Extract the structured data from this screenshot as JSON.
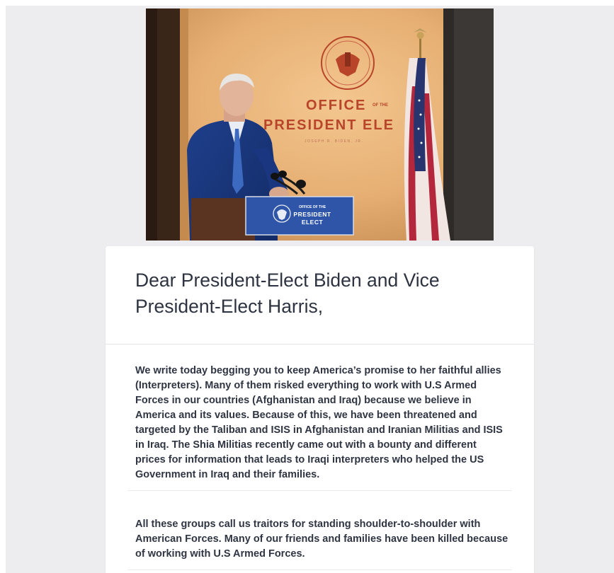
{
  "hero": {
    "backdrop_line1": "OFFICE",
    "backdrop_ofthe": "OF THE",
    "backdrop_line2": "PRESIDENT ELE",
    "backdrop_name": "JOSEPH R. BIDEN, JR.",
    "podium_small": "OFFICE OF THE",
    "podium_line1": "PRESIDENT",
    "podium_line2": "ELECT"
  },
  "letter": {
    "title": "Dear President-Elect Biden and Vice President-Elect Harris,",
    "paragraphs": [
      "We write today begging you to keep America’s promise to her faithful allies (Interpreters). Many of them risked everything to work with U.S Armed Forces in our countries (Afghanistan and Iraq) because we believe in America and its values. Because of this, we have been threatened and targeted by the Taliban and ISIS in Afghanistan and Iranian Militias and ISIS in Iraq. The Shia Militias recently came out with a bounty and different prices for information that leads to Iraqi interpreters who helped the US Government in Iraq and their families.",
      "All these groups call us traitors for standing shoulder-to-shoulder with American Forces. Many of our friends and families have been killed because of working with U.S Armed Forces."
    ]
  },
  "colors": {
    "page_bg": "#ededf0",
    "card_bg": "#ffffff",
    "text": "#2f3542",
    "backdrop": "#e9b478",
    "backdrop_text": "#b8442a",
    "podium_sign": "#2f55a8"
  }
}
